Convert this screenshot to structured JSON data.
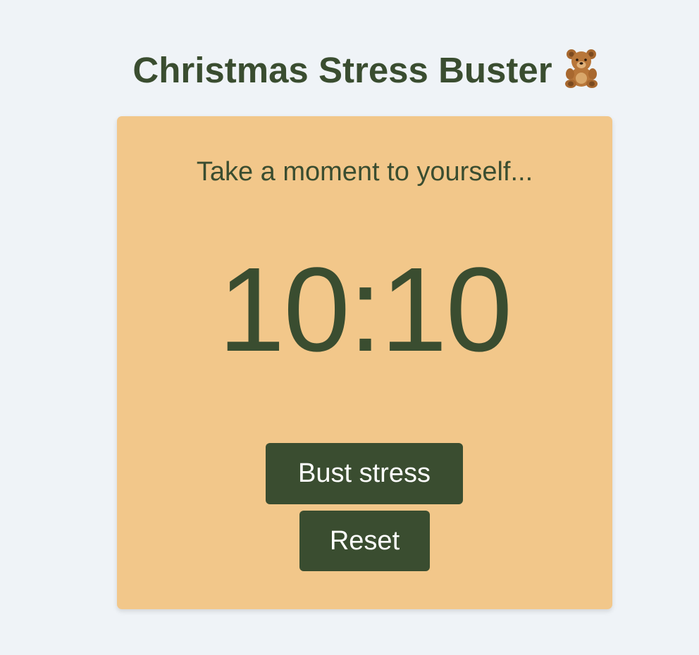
{
  "header": {
    "title": "Christmas Stress Buster",
    "emoji_icon": "teddy-bear-icon"
  },
  "card": {
    "subtitle": "Take a moment to yourself...",
    "timer": "10:10",
    "bust_label": "Bust stress",
    "reset_label": "Reset"
  },
  "colors": {
    "background": "#eff3f7",
    "card": "#f2c78a",
    "accent": "#3a4d30",
    "button_text": "#ffffff"
  }
}
